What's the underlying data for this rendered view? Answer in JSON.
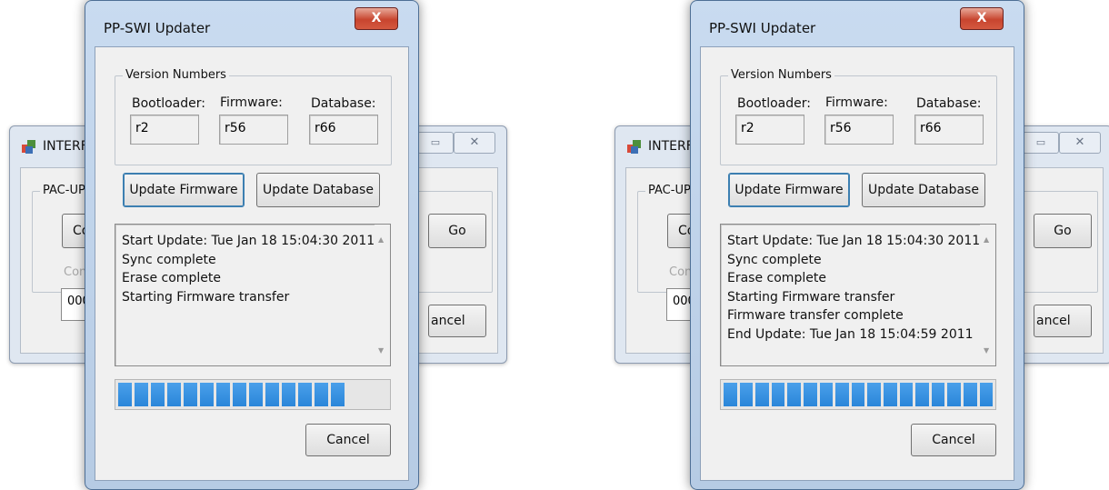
{
  "screens": [
    {
      "background_window": {
        "title": "INTERFA",
        "group_label": "PAC-UP",
        "connect_button": "Conn",
        "connect_status": "Connec",
        "id_value": "0001",
        "go_button": "Go",
        "cancel_button": "ancel",
        "restore_glyph": "▭",
        "close_glyph": "✕"
      },
      "dialog": {
        "title": "PP-SWI Updater",
        "close_glyph": "X",
        "version_group": "Version Numbers",
        "bootloader_label": "Bootloader:",
        "firmware_label": "Firmware:",
        "database_label": "Database:",
        "bootloader_value": "r2",
        "firmware_value": "r56",
        "database_value": "r66",
        "update_firmware_button": "Update Firmware",
        "update_database_button": "Update Database",
        "log_lines": [
          "Start Update: Tue Jan 18 15:04:30 2011",
          "Sync complete",
          "Erase complete",
          "Starting Firmware transfer"
        ],
        "progress_blocks_filled": 14,
        "progress_blocks_total": 17,
        "cancel_button": "Cancel"
      }
    },
    {
      "background_window": {
        "title": "INTERFA",
        "group_label": "PAC-UP",
        "connect_button": "Conn",
        "connect_status": "Connec",
        "id_value": "0001",
        "go_button": "Go",
        "cancel_button": "ancel",
        "restore_glyph": "▭",
        "close_glyph": "✕"
      },
      "dialog": {
        "title": "PP-SWI Updater",
        "close_glyph": "X",
        "version_group": "Version Numbers",
        "bootloader_label": "Bootloader:",
        "firmware_label": "Firmware:",
        "database_label": "Database:",
        "bootloader_value": "r2",
        "firmware_value": "r56",
        "database_value": "r66",
        "update_firmware_button": "Update Firmware",
        "update_database_button": "Update Database",
        "log_lines": [
          "Start Update: Tue Jan 18 15:04:30 2011",
          "Sync complete",
          "Erase complete",
          "Starting Firmware transfer",
          "Firmware transfer complete",
          "End Update: Tue Jan 18 15:04:59 2011"
        ],
        "progress_blocks_filled": 17,
        "progress_blocks_total": 17,
        "cancel_button": "Cancel"
      }
    }
  ],
  "colors": {
    "progress_fill": "#2a86d9",
    "dialog_frame": "#b6cbe4",
    "close_button": "#c8452f"
  },
  "icons": [
    "app-icon",
    "restore-icon",
    "close-icon",
    "scroll-up-icon",
    "scroll-down-icon"
  ]
}
